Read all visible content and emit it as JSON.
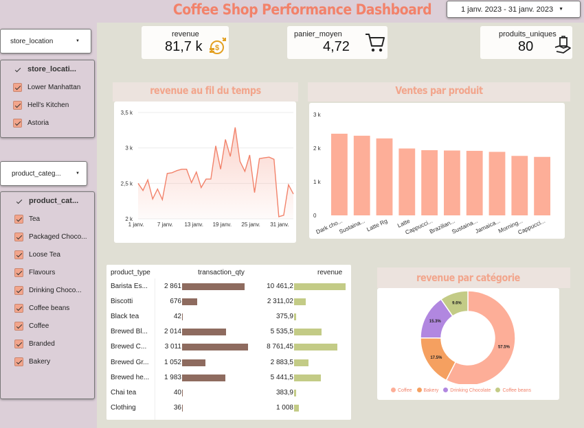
{
  "title": "Coffee Shop Performance Dashboard",
  "date_range": "1 janv. 2023 - 31 janv. 2023",
  "filters": {
    "store_location": {
      "dropdown_label": "store_location",
      "header": "store_locati...",
      "items": [
        "Lower Manhattan",
        "Hell's Kitchen",
        "Astoria"
      ]
    },
    "product_category": {
      "dropdown_label": "product_categ...",
      "header": "product_cat...",
      "items": [
        "Tea",
        "Packaged Choco...",
        "Loose Tea",
        "Flavours",
        "Drinking Choco...",
        "Coffee beans",
        "Coffee",
        "Branded",
        "Bakery"
      ]
    }
  },
  "kpis": {
    "revenue": {
      "label": "revenue",
      "value": "81,7 k",
      "icon": "coins-dollar-icon"
    },
    "panier_moyen": {
      "label": "panier_moyen",
      "value": "4,72",
      "icon": "shopping-cart-icon"
    },
    "produits_uniques": {
      "label": "produits_uniques",
      "value": "80",
      "icon": "hand-bag-icon"
    }
  },
  "colors": {
    "accent": "#f2826a",
    "bar": "#fdae98",
    "line": "#f2826a",
    "qty_bar": "#8e6b5f",
    "revenue_bar": "#c3cb86"
  },
  "chart_data": [
    {
      "type": "area",
      "title": "revenue au fil du temps",
      "xlabel": "",
      "ylabel": "",
      "x_ticks": [
        "1 janv.",
        "7 janv.",
        "13 janv.",
        "19 janv.",
        "25 janv.",
        "31 janv."
      ],
      "y_ticks": [
        "2 k",
        "2,5 k",
        "3 k",
        "3,5 k"
      ],
      "ylim": [
        2000,
        3500
      ],
      "x": [
        1,
        2,
        3,
        4,
        5,
        6,
        7,
        8,
        9,
        10,
        11,
        12,
        13,
        14,
        15,
        16,
        17,
        18,
        19,
        20,
        21,
        22,
        23,
        24,
        25,
        26,
        27,
        28,
        29,
        30,
        31
      ],
      "values": [
        2500,
        2400,
        2550,
        2280,
        2420,
        2270,
        2640,
        2650,
        2680,
        2700,
        2700,
        2510,
        2660,
        2440,
        2560,
        2560,
        3030,
        2700,
        3120,
        2880,
        3290,
        2810,
        2670,
        2900,
        2370,
        2850,
        2860,
        2870,
        2840,
        2030,
        2050,
        2480,
        2350
      ]
    },
    {
      "type": "bar",
      "title": "Ventes par produit",
      "xlabel": "",
      "ylabel": "",
      "y_ticks": [
        "0",
        "1 k",
        "2 k",
        "3 k"
      ],
      "ylim": [
        0,
        3000
      ],
      "categories": [
        "Dark cho...",
        "Sustaina...",
        "Latte Rg",
        "Latte",
        "Cappucci...",
        "Brazilian...",
        "Sustaina...",
        "Jamaica...",
        "Morning...",
        "Cappucci..."
      ],
      "values": [
        2430,
        2370,
        2290,
        1990,
        1940,
        1930,
        1920,
        1890,
        1770,
        1740
      ]
    },
    {
      "type": "table",
      "columns": [
        "product_type",
        "transaction_qty",
        "revenue"
      ],
      "qty_max": 3011,
      "revenue_max": 10461.2,
      "rows": [
        {
          "product_type": "Barista Es...",
          "qty": 2861,
          "qty_label": "2 861",
          "revenue": 10461.2,
          "revenue_label": "10 461,2"
        },
        {
          "product_type": "Biscotti",
          "qty": 676,
          "qty_label": "676",
          "revenue": 2311.02,
          "revenue_label": "2 311,02"
        },
        {
          "product_type": "Black tea",
          "qty": 42,
          "qty_label": "42",
          "revenue": 375.9,
          "revenue_label": "375,9"
        },
        {
          "product_type": "Brewed Bl...",
          "qty": 2014,
          "qty_label": "2 014",
          "revenue": 5535.5,
          "revenue_label": "5 535,5"
        },
        {
          "product_type": "Brewed C...",
          "qty": 3011,
          "qty_label": "3 011",
          "revenue": 8761.45,
          "revenue_label": "8 761,45"
        },
        {
          "product_type": "Brewed Gr...",
          "qty": 1052,
          "qty_label": "1 052",
          "revenue": 2883.5,
          "revenue_label": "2 883,5"
        },
        {
          "product_type": "Brewed he...",
          "qty": 1983,
          "qty_label": "1 983",
          "revenue": 5441.5,
          "revenue_label": "5 441,5"
        },
        {
          "product_type": "Chai tea",
          "qty": 40,
          "qty_label": "40",
          "revenue": 383.9,
          "revenue_label": "383,9"
        },
        {
          "product_type": "Clothing",
          "qty": 36,
          "qty_label": "36",
          "revenue": 1008,
          "revenue_label": "1 008"
        }
      ]
    },
    {
      "type": "pie",
      "title": "revenue par catégorie",
      "categories": [
        "Coffee",
        "Bakery",
        "Drinking Chocolate",
        "Coffee beans"
      ],
      "values": [
        57.5,
        17.5,
        15.3,
        9.6
      ],
      "labels": [
        "57.5%",
        "17.5%",
        "15.3%",
        "9.6%"
      ],
      "colors": [
        "#fdae98",
        "#f5a060",
        "#b187e0",
        "#c3cb86"
      ],
      "legend": "bottom"
    }
  ]
}
